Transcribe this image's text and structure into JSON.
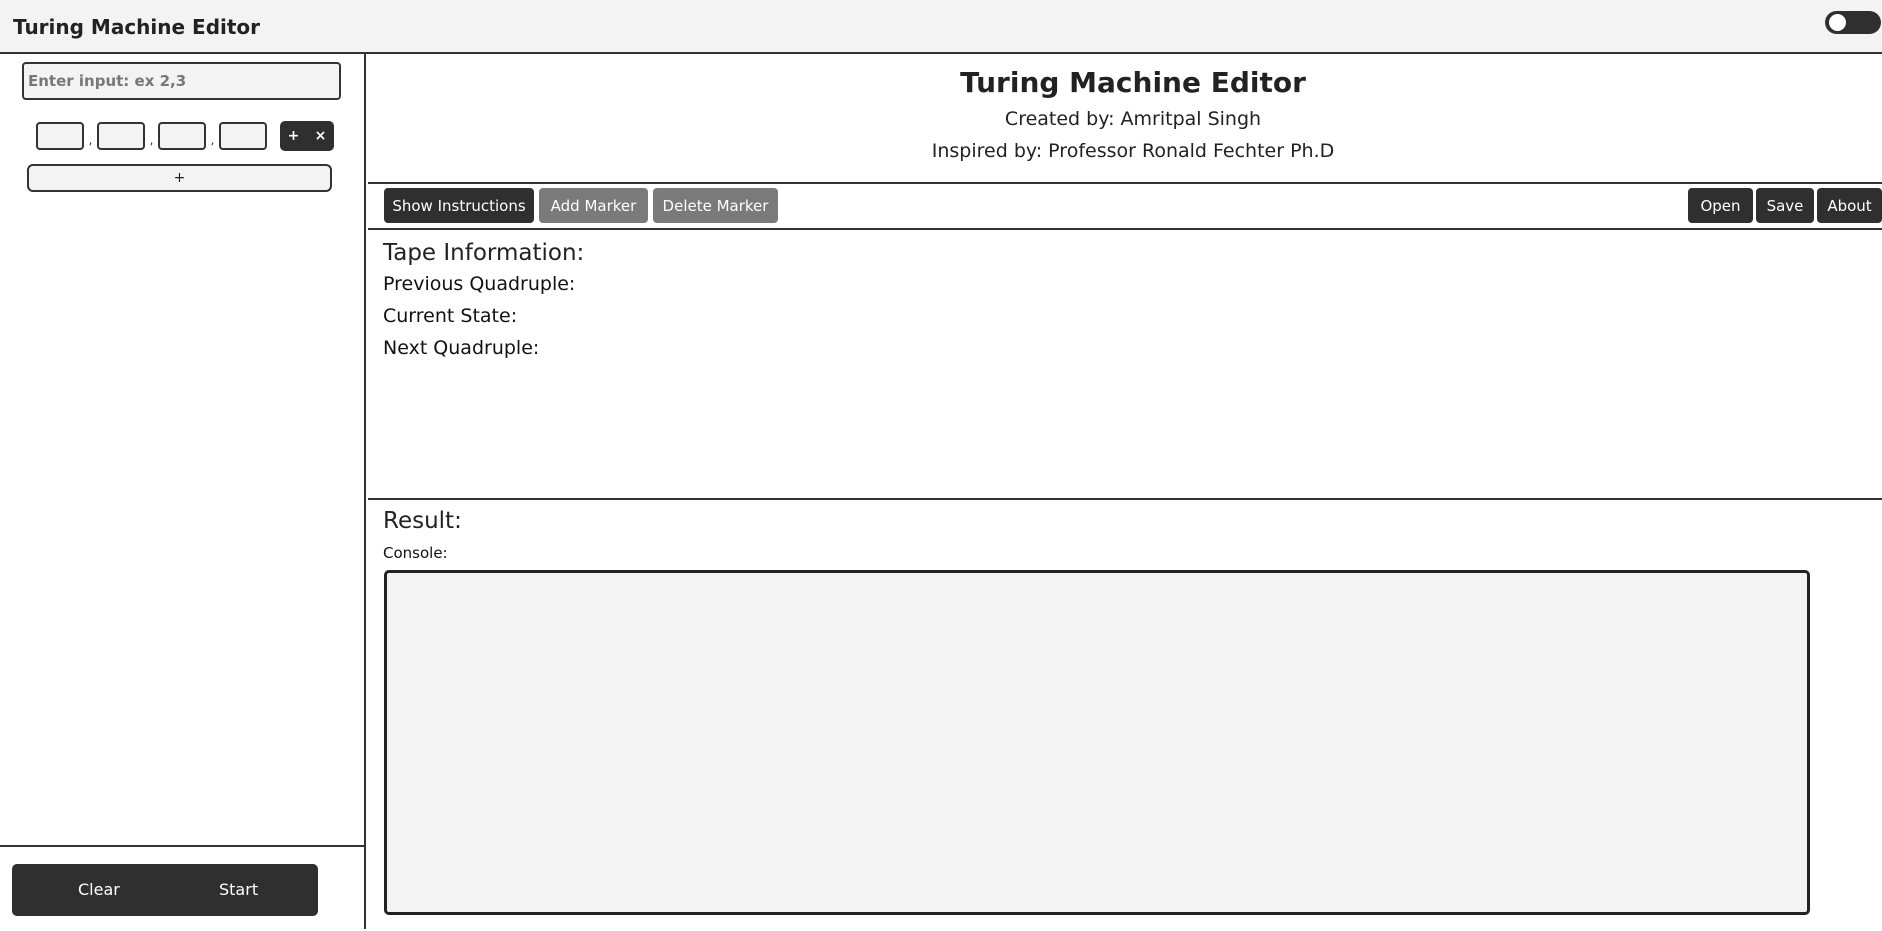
{
  "app": {
    "title": "Turing Machine Editor",
    "theme_toggle": "off"
  },
  "sidebar": {
    "input_placeholder": "Enter input: ex 2,3",
    "quadruple": {
      "separator": ",",
      "add_label": "+",
      "remove_label": "×"
    },
    "add_row_label": "+",
    "clear_label": "Clear",
    "start_label": "Start"
  },
  "header": {
    "title": "Turing Machine Editor",
    "created_by": "Created by: Amritpal Singh",
    "inspired_by": "Inspired by: Professor Ronald Fechter Ph.D"
  },
  "toolbar": {
    "show_instructions": "Show Instructions",
    "add_marker": "Add Marker",
    "delete_marker": "Delete Marker",
    "open": "Open",
    "save": "Save",
    "about": "About"
  },
  "tape": {
    "heading": "Tape Information:",
    "previous_quadruple": "Previous Quadruple:",
    "current_state": "Current State:",
    "next_quadruple": "Next Quadruple:"
  },
  "result": {
    "heading": "Result:",
    "console_label": "Console:"
  },
  "colors": {
    "dark_button": "#2f2f2f",
    "gray_button": "#7a7a7a",
    "panel_background": "#f3f3f3",
    "border": "#333333"
  }
}
